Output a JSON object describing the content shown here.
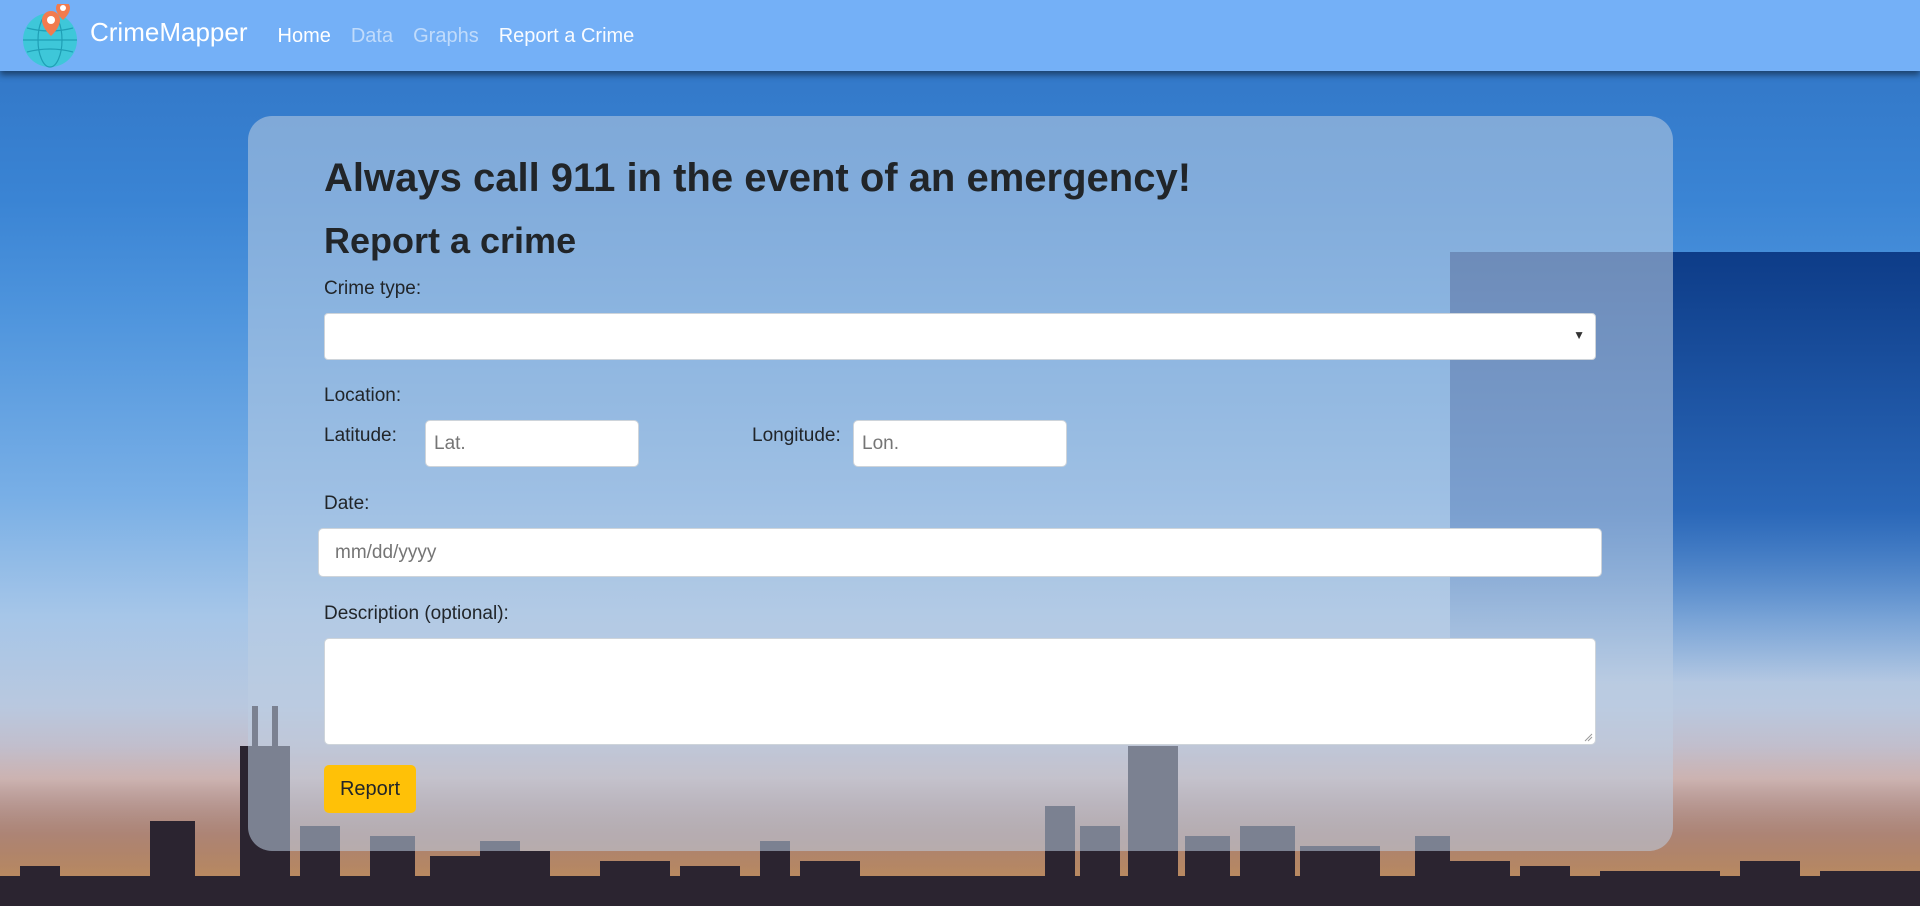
{
  "navbar": {
    "brand": "CrimeMapper",
    "links": [
      {
        "label": "Home",
        "state": "active"
      },
      {
        "label": "Data",
        "state": "muted"
      },
      {
        "label": "Graphs",
        "state": "muted"
      },
      {
        "label": "Report a Crime",
        "state": "normal"
      }
    ]
  },
  "form": {
    "alert_heading": "Always call 911 in the event of an emergency!",
    "title": "Report a crime",
    "crime_type_label": "Crime type:",
    "crime_type_value": "",
    "location_label": "Location:",
    "latitude_label": "Latitude:",
    "latitude_placeholder": "Lat.",
    "longitude_label": "Longitude:",
    "longitude_placeholder": "Lon.",
    "date_label": "Date:",
    "date_placeholder": "mm/dd/yyyy",
    "description_label": "Description (optional):",
    "description_value": "",
    "submit_label": "Report"
  },
  "colors": {
    "navbar": "#74b0f7",
    "submit_button": "#ffc107"
  }
}
